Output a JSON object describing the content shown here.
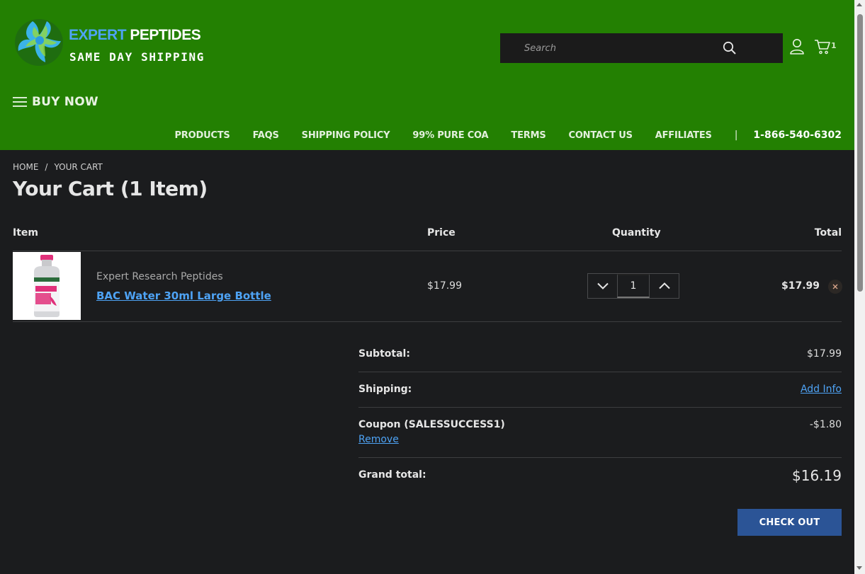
{
  "header": {
    "logo": {
      "word1": "EXPERT",
      "word2": "PEPTIDES",
      "tagline": "SAME DAY SHIPPING"
    },
    "search": {
      "placeholder": "Search",
      "icon": "search-icon"
    },
    "account_icon": "user-icon",
    "cart": {
      "icon": "cart-icon",
      "count": "1"
    },
    "menu": {
      "label": "BUY NOW",
      "icon": "hamburger-icon"
    },
    "nav": [
      "PRODUCTS",
      "FAQS",
      "SHIPPING POLICY",
      "99% PURE COA",
      "TERMS",
      "CONTACT US",
      "AFFILIATES"
    ],
    "separator": "|",
    "phone": "1-866-540-6302"
  },
  "breadcrumb": {
    "home": "HOME",
    "separator": "/",
    "current": "YOUR CART"
  },
  "page_title": "Your Cart (1 Item)",
  "cart_table": {
    "headers": {
      "item": "Item",
      "price": "Price",
      "quantity": "Quantity",
      "total": "Total"
    },
    "rows": [
      {
        "brand": "Expert Research Peptides",
        "name": "BAC Water 30ml Large Bottle",
        "price": "$17.99",
        "quantity": "1",
        "total": "$17.99"
      }
    ]
  },
  "summary": {
    "subtotal_label": "Subtotal:",
    "subtotal_value": "$17.99",
    "shipping_label": "Shipping:",
    "shipping_value": "Add Info",
    "coupon_label": "Coupon (SALESSUCCESS1)",
    "coupon_value": "-$1.80",
    "coupon_remove": "Remove",
    "grand_label": "Grand total:",
    "grand_value": "$16.19"
  },
  "checkout_label": "CHECK OUT",
  "colors": {
    "header_bg": "#238002",
    "page_bg": "#1b1c1e",
    "link": "#4ea3f5",
    "checkout_bg": "#2b5496",
    "logo_blue": "#4ea3f5"
  }
}
